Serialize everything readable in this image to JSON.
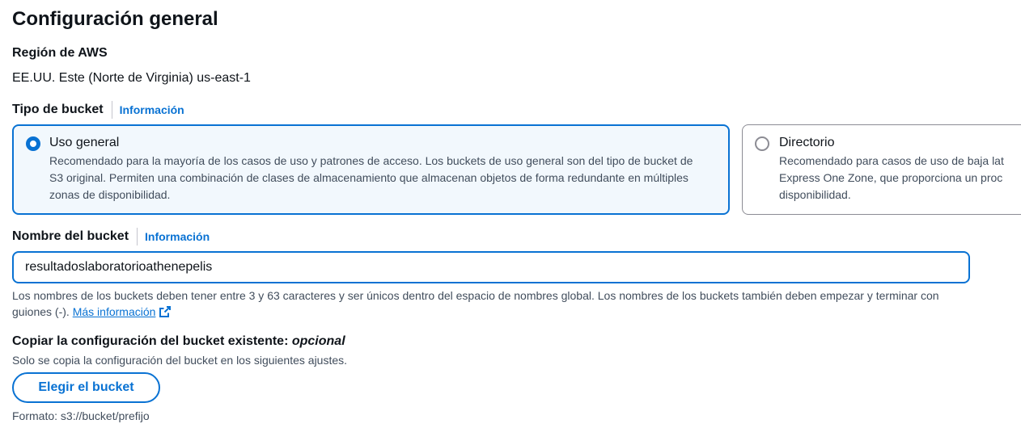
{
  "section": {
    "title": "Configuración general"
  },
  "region": {
    "label": "Región de AWS",
    "value": "EE.UU. Este (Norte de Virginia) us-east-1"
  },
  "bucket_type": {
    "label": "Tipo de bucket",
    "info_link": "Información",
    "options": [
      {
        "title": "Uso general",
        "selected": true,
        "description": "Recomendado para la mayoría de los casos de uso y patrones de acceso. Los buckets de uso general son del tipo de bucket de S3 original. Permiten una combinación de clases de almacenamiento que almacenan objetos de forma redundante en múltiples zonas de disponibilidad."
      },
      {
        "title": "Directorio",
        "selected": false,
        "description": "Recomendado para casos de uso de baja lat Express One Zone, que proporciona un proc disponibilidad."
      }
    ]
  },
  "bucket_name": {
    "label": "Nombre del bucket",
    "info_link": "Información",
    "value": "resultadoslaboratorioathenepelis",
    "help": "Los nombres de los buckets deben tener entre 3 y 63 caracteres y ser únicos dentro del espacio de nombres global. Los nombres de los buckets también deben empezar y terminar con",
    "help_line2": "guiones (-).",
    "more_link": "Más información"
  },
  "copy_config": {
    "label": "Copiar la configuración del bucket existente:",
    "optional": "opcional",
    "help": "Solo se copia la configuración del bucket en los siguientes ajustes.",
    "button": "Elegir el bucket",
    "format": "Formato: s3://bucket/prefijo"
  },
  "colors": {
    "accent": "#0972d3",
    "selected_tile_bg": "#f2f8fd",
    "text": "#0f141a",
    "secondary_text": "#414d5c"
  },
  "icons": [
    "external-link-icon",
    "radio-checked-icon",
    "radio-unchecked-icon"
  ]
}
